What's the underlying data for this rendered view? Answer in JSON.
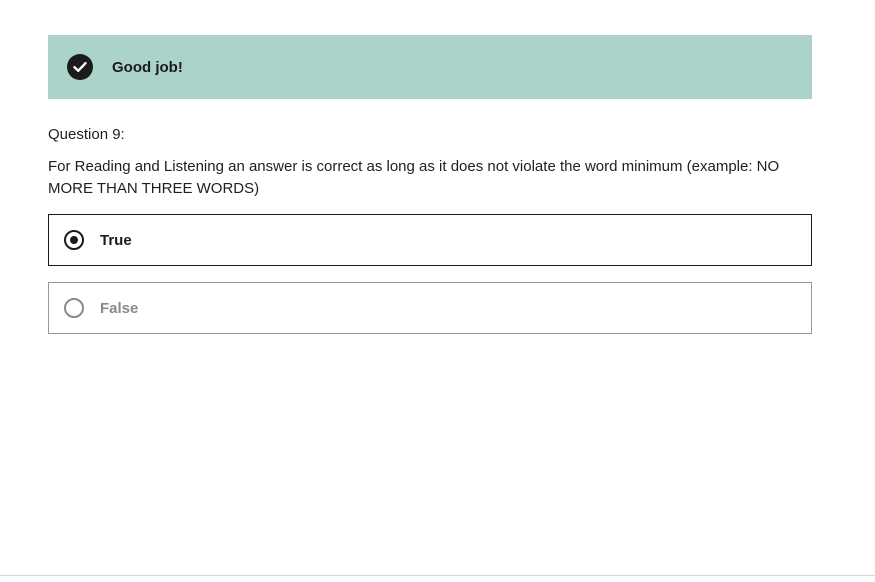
{
  "feedback": {
    "status": "correct",
    "message": "Good job!",
    "icon": "check-circle-icon",
    "background_color": "#abd3cb"
  },
  "question": {
    "number_label": "Question 9:",
    "text": "For Reading and Listening an answer is correct as long as it does not violate the word minimum (example: NO MORE THAN THREE WORDS)"
  },
  "options": [
    {
      "label": "True",
      "selected": true
    },
    {
      "label": "False",
      "selected": false
    }
  ]
}
